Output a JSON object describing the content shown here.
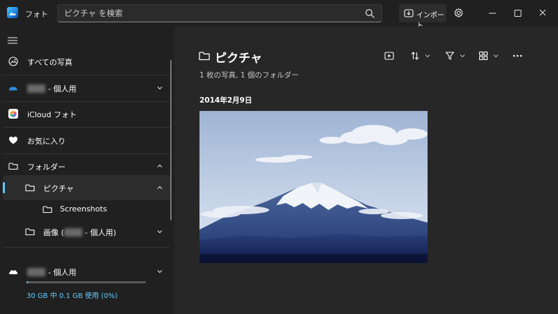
{
  "app": {
    "title": "フォト"
  },
  "search": {
    "placeholder": "ピクチャ を検索"
  },
  "titlebar": {
    "import_label": "インポート"
  },
  "sidebar": {
    "all_photos": "すべての写真",
    "onedrive_label": "- 個人用",
    "icloud": "iCloud フォト",
    "favorites": "お気に入り",
    "folders": "フォルダー",
    "pictures": "ピクチャ",
    "screenshots": "Screenshots",
    "images_label_prefix": "画像 (",
    "images_label_suffix": "- 個人用)",
    "cloud_account_label": "- 個人用",
    "storage_text": "30 GB 中 0.1 GB 使用 (0%)",
    "storage_used_fraction": 0.003
  },
  "main": {
    "title": "ピクチャ",
    "subtitle": "1 枚の写真, 1 個のフォルダー",
    "date_group": "2014年2月9日"
  },
  "colors": {
    "accent": "#60cdff",
    "background": "#202020",
    "content": "#272727"
  }
}
